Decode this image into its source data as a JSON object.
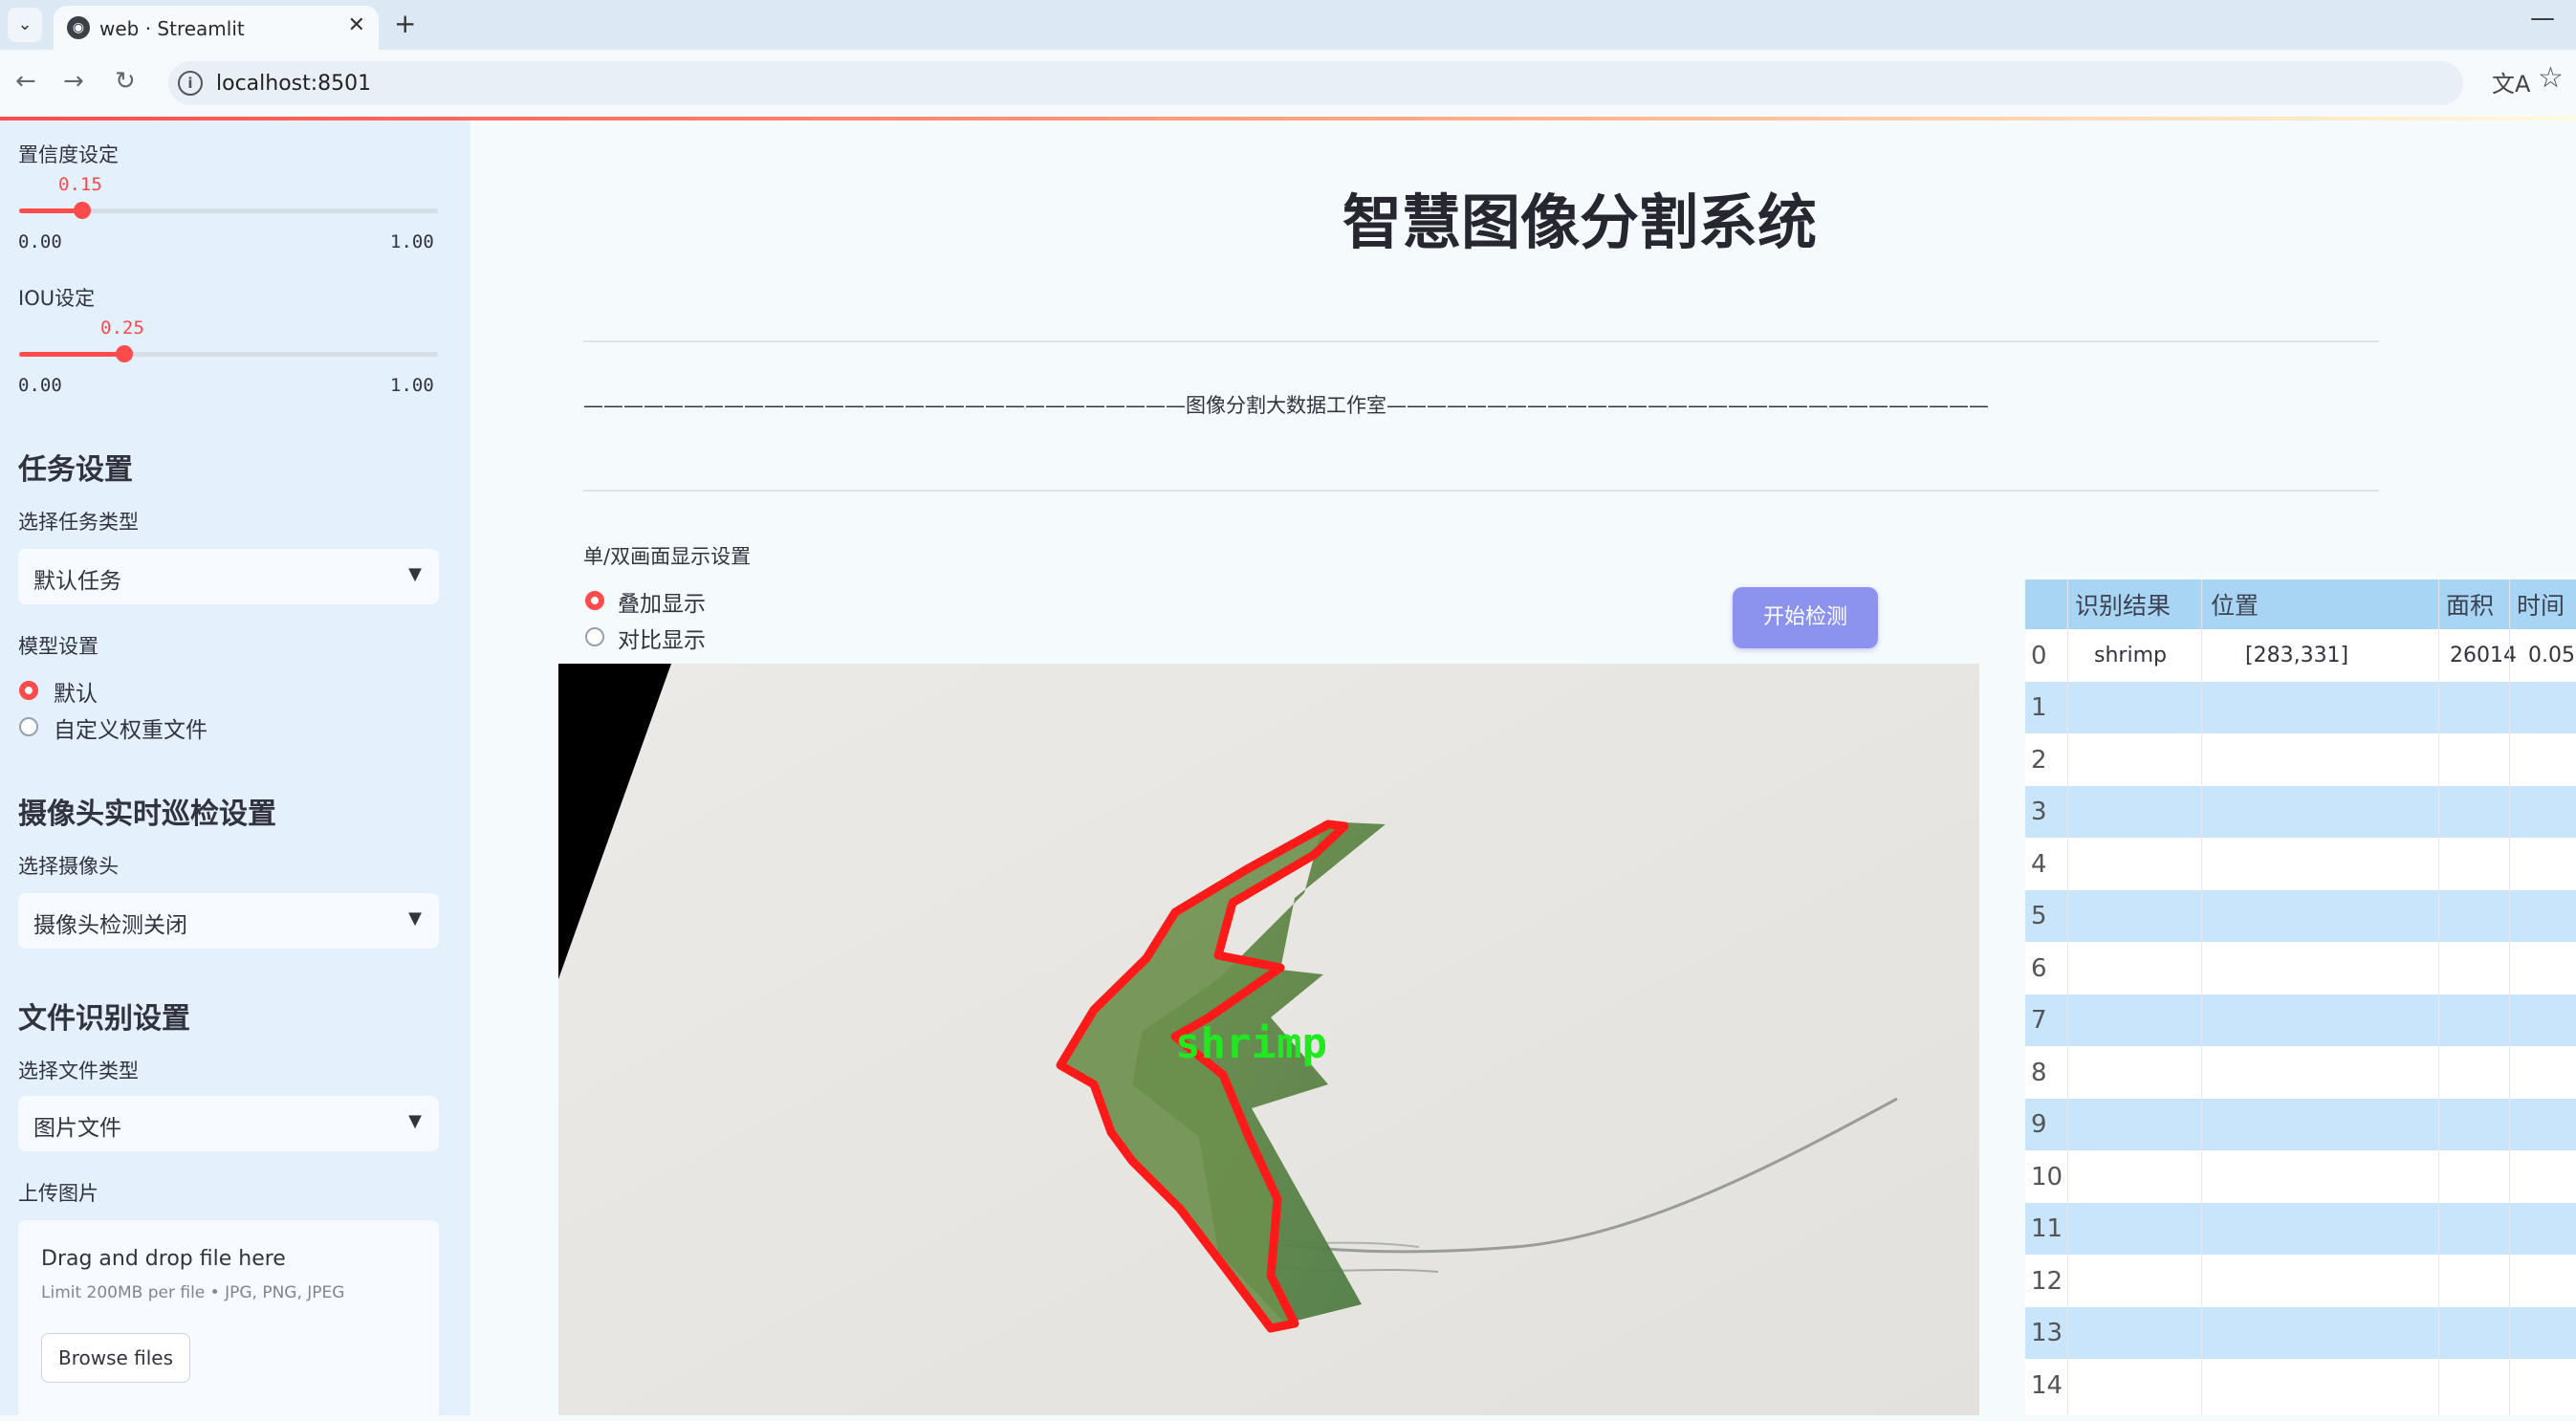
{
  "browser": {
    "tab_title": "web · Streamlit",
    "url": "localhost:8501"
  },
  "sidebar": {
    "confidence": {
      "label": "置信度设定",
      "value": "0.15",
      "value_num": 0.15,
      "min": "0.00",
      "max": "1.00"
    },
    "iou": {
      "label": "IOU设定",
      "value": "0.25",
      "value_num": 0.25,
      "min": "0.00",
      "max": "1.00"
    },
    "task_header": "任务设置",
    "task_type_label": "选择任务类型",
    "task_type_value": "默认任务",
    "model_label": "模型设置",
    "model_options": [
      "默认",
      "自定义权重文件"
    ],
    "model_selected": "默认",
    "camera_header": "摄像头实时巡检设置",
    "camera_label": "选择摄像头",
    "camera_value": "摄像头检测关闭",
    "file_header": "文件识别设置",
    "file_type_label": "选择文件类型",
    "file_type_value": "图片文件",
    "upload_label": "上传图片",
    "upload_drop": "Drag and drop file here",
    "upload_limit": "Limit 200MB per file • JPG, PNG, JPEG",
    "upload_button": "Browse files"
  },
  "main": {
    "title": "智慧图像分割系统",
    "banner": "——————————————————————————————图像分割大数据工作室——————————————————————————————",
    "display_label": "单/双画面显示设置",
    "display_options": [
      "叠加显示",
      "对比显示"
    ],
    "display_selected": "叠加显示",
    "detect_button": "开始检测",
    "detection_label": "shrimp"
  },
  "table": {
    "columns": [
      "识别结果",
      "位置",
      "面积",
      "时间"
    ],
    "row_indices": [
      "0",
      "1",
      "2",
      "3",
      "4",
      "5",
      "6",
      "7",
      "8",
      "9",
      "10",
      "11",
      "12",
      "13",
      "14"
    ],
    "rows": [
      {
        "result": "shrimp",
        "position": "[283,331]",
        "area": "26014",
        "time": "0.05"
      }
    ]
  },
  "colors": {
    "accent": "#ff4b4b",
    "sidebar_bg": "#e4f0fb",
    "header_row": "#a9d5f5",
    "stripe_row": "#c8e5fb",
    "detect_button": "#8c93ef",
    "mask_outline": "#ff1a1a",
    "label_text": "#22e822"
  },
  "icons": [
    "chevron-down-icon",
    "streamlit-favicon-icon",
    "close-icon",
    "plus-icon",
    "back-icon",
    "forward-icon",
    "reload-icon",
    "info-icon",
    "translate-icon",
    "star-icon",
    "minimize-icon"
  ]
}
